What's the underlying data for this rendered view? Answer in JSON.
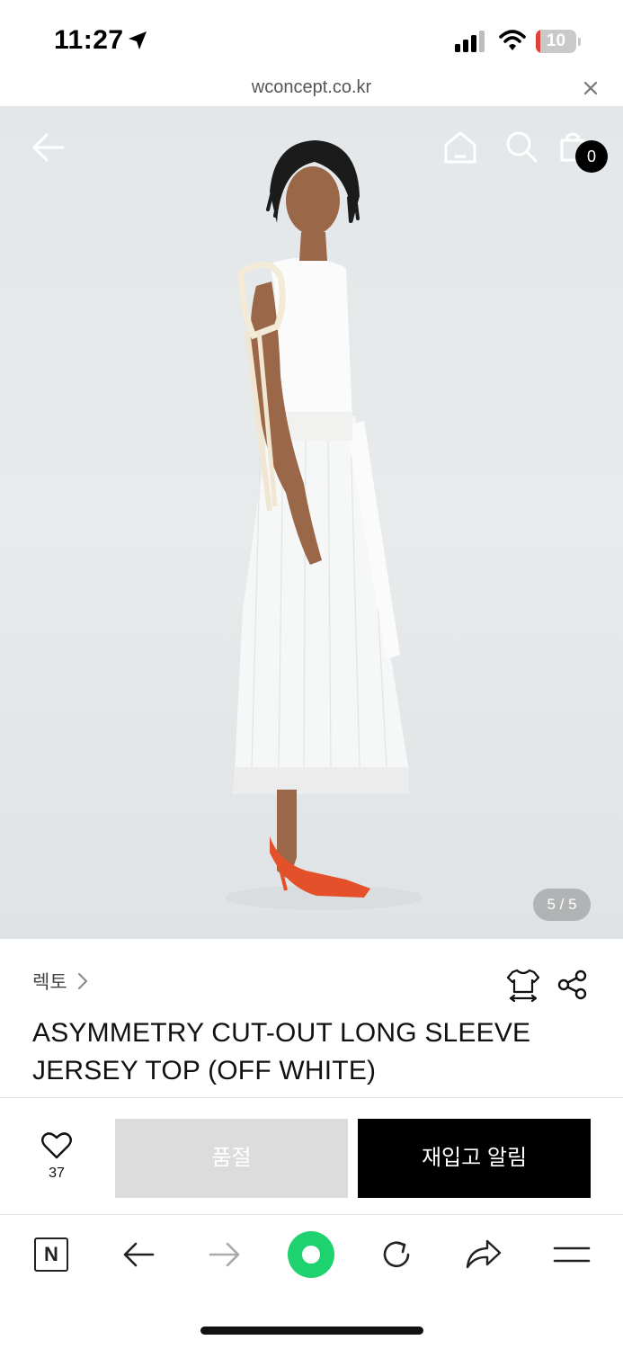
{
  "status_bar": {
    "time": "11:27",
    "battery_level": "10",
    "battery_fraction": 0.1,
    "icons": [
      "location-arrow-icon",
      "cellular-signal-icon",
      "wifi-icon",
      "battery-icon"
    ]
  },
  "browser": {
    "url": "wconcept.co.kr",
    "close_icon": "close-icon"
  },
  "hero": {
    "image_alt": "Model wearing off white asymmetry cut-out top and white pleated skirt",
    "counter": "5 / 5",
    "cart_count": "0",
    "icons": [
      "back-arrow-icon",
      "home-icon",
      "search-icon",
      "shopping-bag-icon"
    ]
  },
  "product": {
    "brand": "렉토",
    "title": "ASYMMETRY CUT-OUT LONG SLEEVE JERSEY TOP (OFF WHITE)",
    "icons": [
      "size-guide-icon",
      "share-icon"
    ]
  },
  "actions": {
    "like_count": "37",
    "soldout_label": "품절",
    "restock_label": "재입고 알림"
  },
  "toolbar": {
    "naver_label": "N",
    "icons": [
      "naver-icon",
      "back-icon",
      "forward-icon",
      "green-dot-icon",
      "reload-icon",
      "share-icon",
      "menu-icon"
    ]
  },
  "colors": {
    "accent_green": "#1fd270",
    "restock_button": "#000000",
    "soldout_button": "#dcdcdc",
    "battery_low": "#e0403a"
  }
}
